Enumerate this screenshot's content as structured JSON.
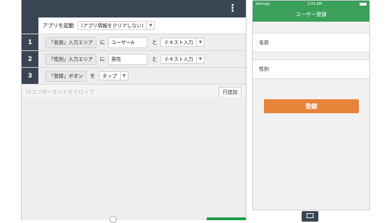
{
  "editor": {
    "menu_icon": "vertical-ellipsis-icon",
    "launch": {
      "label": "アプリを起動",
      "option": "(アプリ情報をクリアしない)"
    },
    "steps": [
      {
        "num": "1",
        "target": "「名前」入力エリア",
        "particle": "に",
        "value": "ユーザーA",
        "connector": "と",
        "action": "テキスト入力"
      },
      {
        "num": "2",
        "target": "「性別」入力エリア",
        "particle": "に",
        "value": "男性",
        "connector": "と",
        "action": "テキスト入力"
      },
      {
        "num": "3",
        "target": "「登録」ボタン",
        "particle": "を",
        "action": "タップ"
      }
    ],
    "drop_placeholder": "UIコンポーネントをドロップ",
    "add_row_label": "行追加"
  },
  "phone": {
    "status_left": "Settings",
    "status_time": "2:03 AM",
    "title": "ユーザー登録",
    "field_name": "名前",
    "field_gender": "性別",
    "register_label": "登録"
  },
  "colors": {
    "header": "#3a4553",
    "green": "#3aa05a",
    "orange": "#e8833a"
  }
}
